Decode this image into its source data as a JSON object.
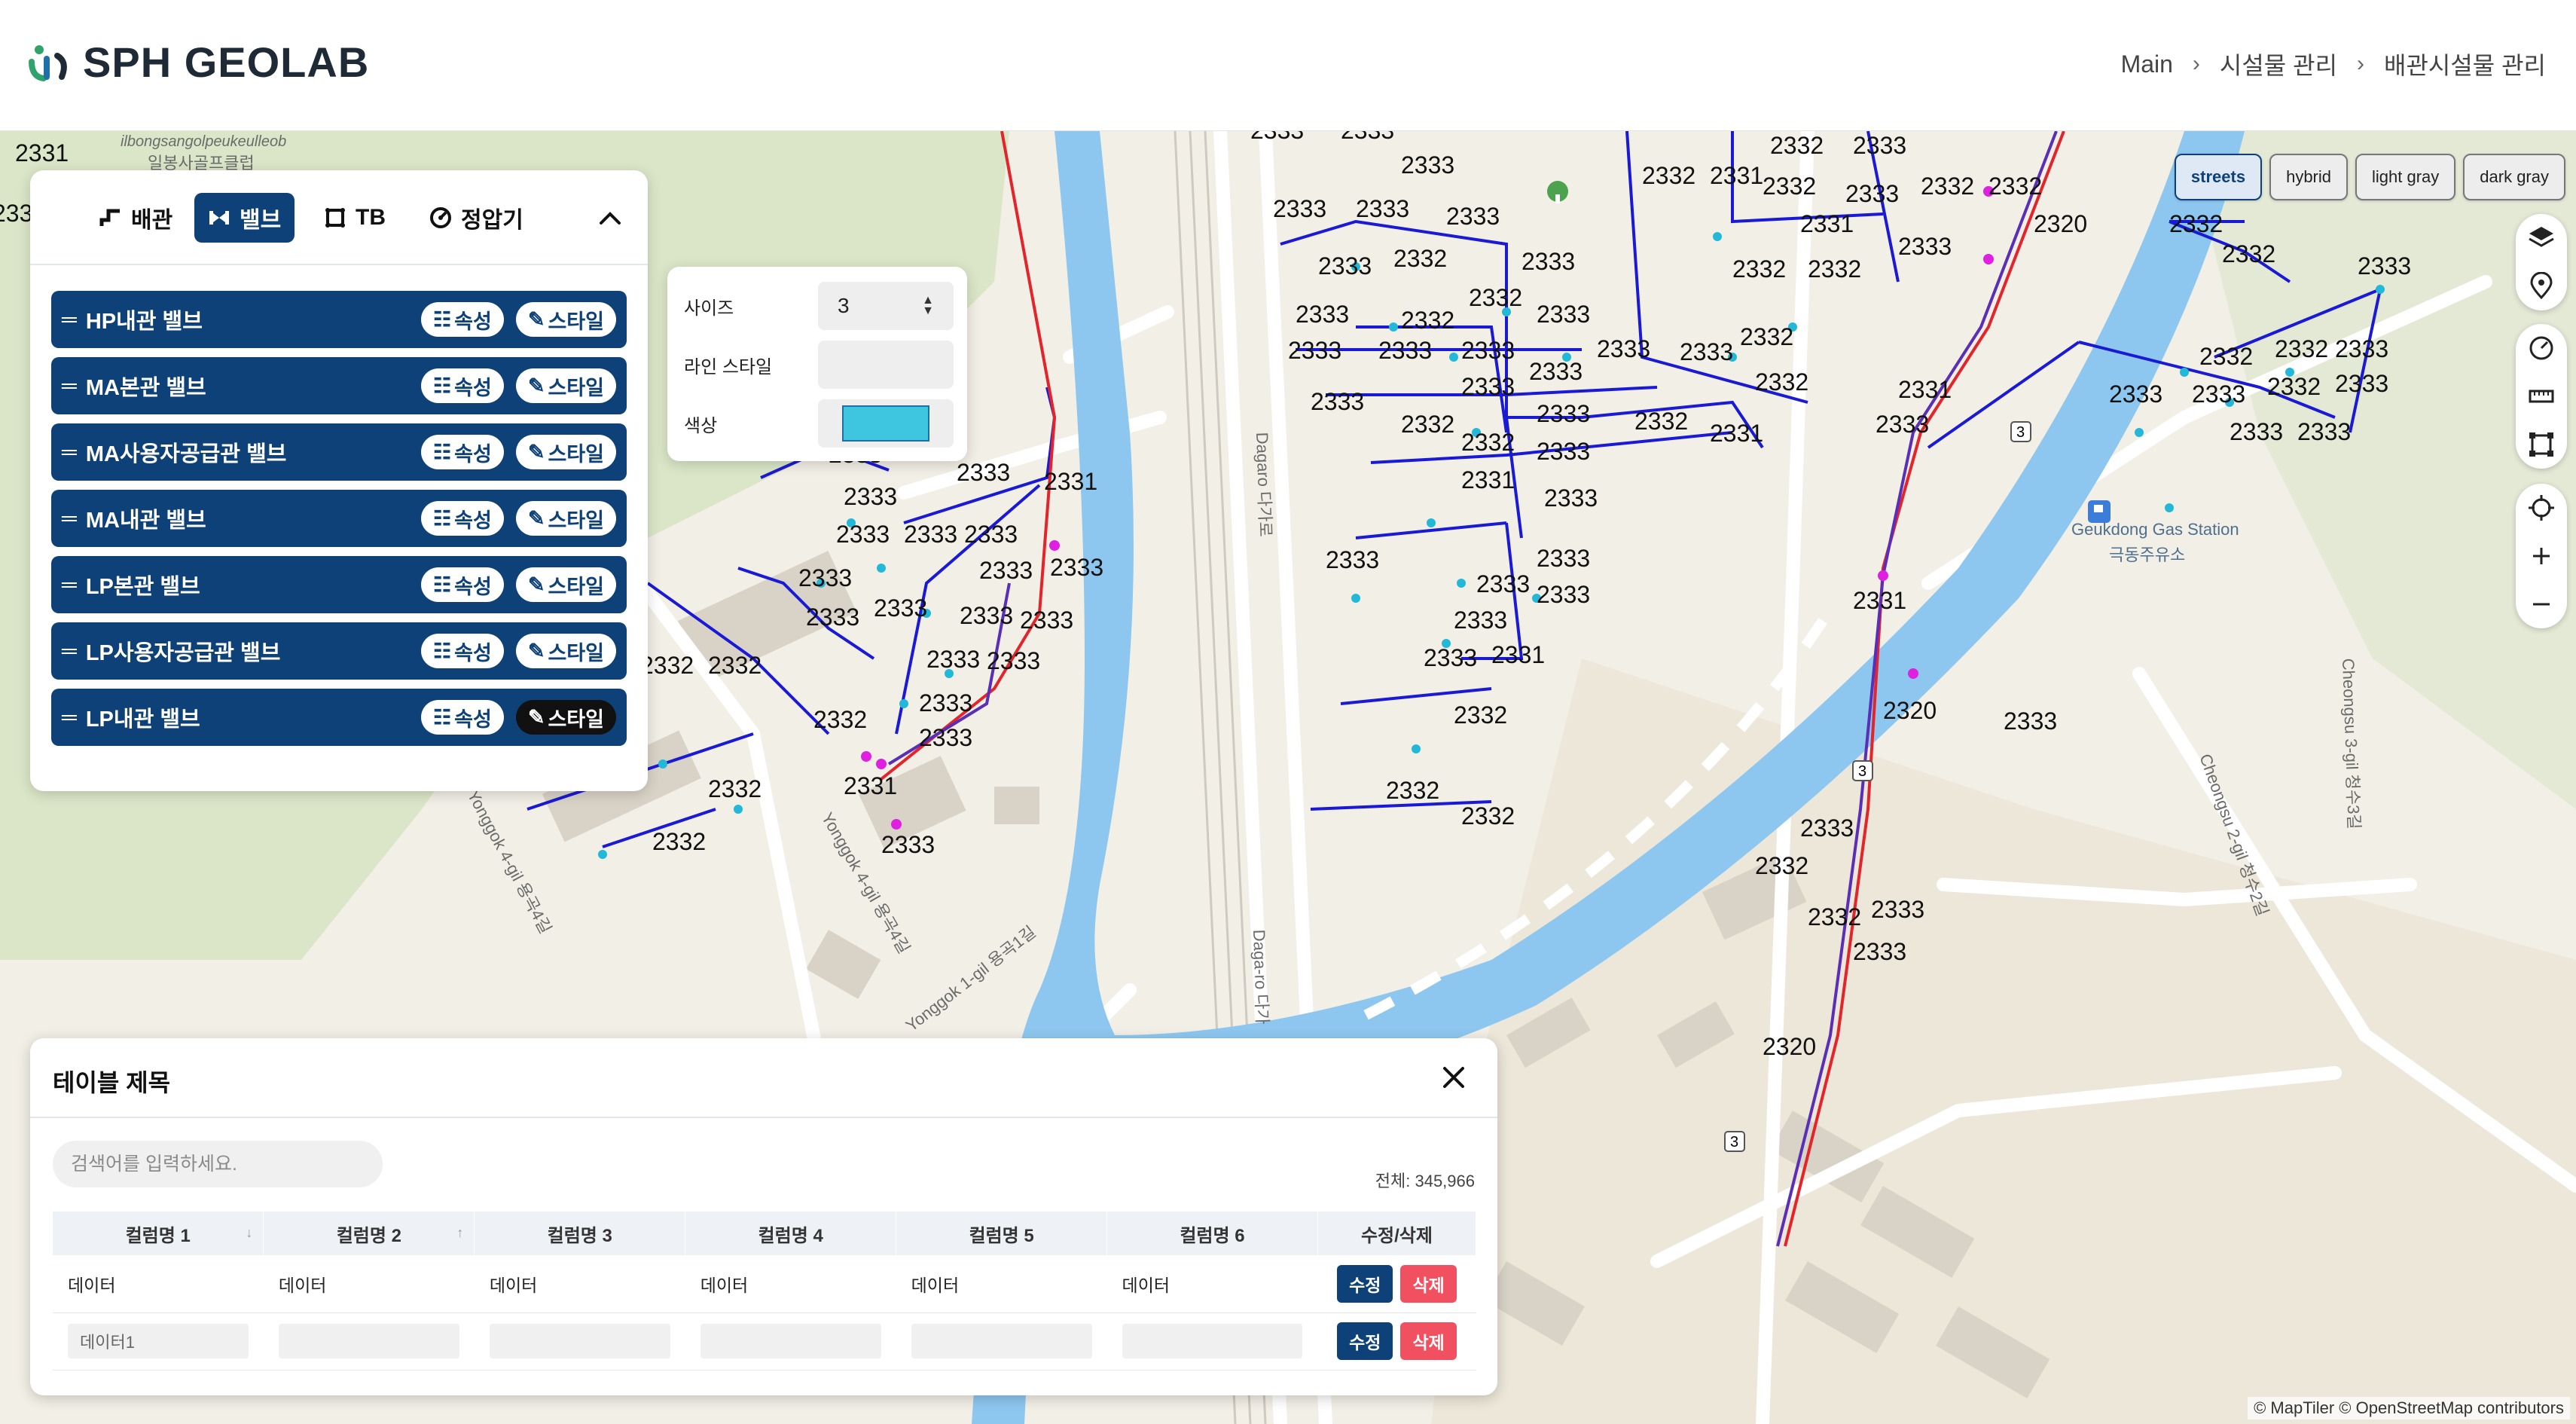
{
  "header": {
    "logo_text": "SPH GEOLAB",
    "breadcrumb": [
      "Main",
      "시설물 관리",
      "배관시설물 관리"
    ]
  },
  "layer_panel": {
    "tabs": [
      {
        "label": "배관",
        "icon": "pipe-icon",
        "active": false
      },
      {
        "label": "밸브",
        "icon": "valve-icon",
        "active": true
      },
      {
        "label": "TB",
        "icon": "tb-icon",
        "active": false
      },
      {
        "label": "정압기",
        "icon": "regulator-icon",
        "active": false
      }
    ],
    "rows": [
      {
        "label": "HP내관 밸브"
      },
      {
        "label": "MA본관 밸브"
      },
      {
        "label": "MA사용자공급관 밸브"
      },
      {
        "label": "MA내관 밸브"
      },
      {
        "label": "LP본관 밸브"
      },
      {
        "label": "LP사용자공급관 밸브"
      },
      {
        "label": "LP내관 밸브"
      }
    ],
    "attr_label": "속성",
    "style_label": "스타일"
  },
  "style_popover": {
    "size_label": "사이즈",
    "size_value": "3",
    "line_style_label": "라인 스타일",
    "color_label": "색상",
    "color_value": "#3ec6e0"
  },
  "basemaps": [
    "streets",
    "hybrid",
    "light gray",
    "dark gray"
  ],
  "basemap_active": "streets",
  "map": {
    "labels": {
      "ilbong": "ilbongsangolpeukeulleob",
      "ilbong_ko": "일봉사골프클럽",
      "gas_station": "Geukdong Gas Station",
      "gas_station_ko": "극동주유소",
      "dagaro1": "Dagaro 다가로",
      "dagaro2": "Daga-ro 다가",
      "yonggok4": "Yonggok 4-gil 용곡4길",
      "yonggok1": "Yonggok 1-gil 용곡1길",
      "yonggok4b": "Yonggok 4-gil 용곡4길",
      "cheongsu3": "Cheongsu 3-gil 청수3길",
      "cheongsu2": "Cheongsu 2-gil 청수2길",
      "route3": "3"
    },
    "pipe_ids": [
      "2331",
      "2332",
      "2333",
      "2320"
    ]
  },
  "table": {
    "title": "테이블 제목",
    "search_placeholder": "검색어를 입력하세요.",
    "total": "전체: 345,966",
    "columns": [
      "컬럼명 1",
      "컬럼명 2",
      "컬럼명 3",
      "컬럼명 4",
      "컬럼명 5",
      "컬럼명 6",
      "수정/삭제"
    ],
    "row1": [
      "데이터",
      "데이터",
      "데이터",
      "데이터",
      "데이터",
      "데이터"
    ],
    "row2_first_value": "데이터1",
    "edit_label": "수정",
    "delete_label": "삭제"
  },
  "attribution": "© MapTiler © OpenStreetMap contributors"
}
